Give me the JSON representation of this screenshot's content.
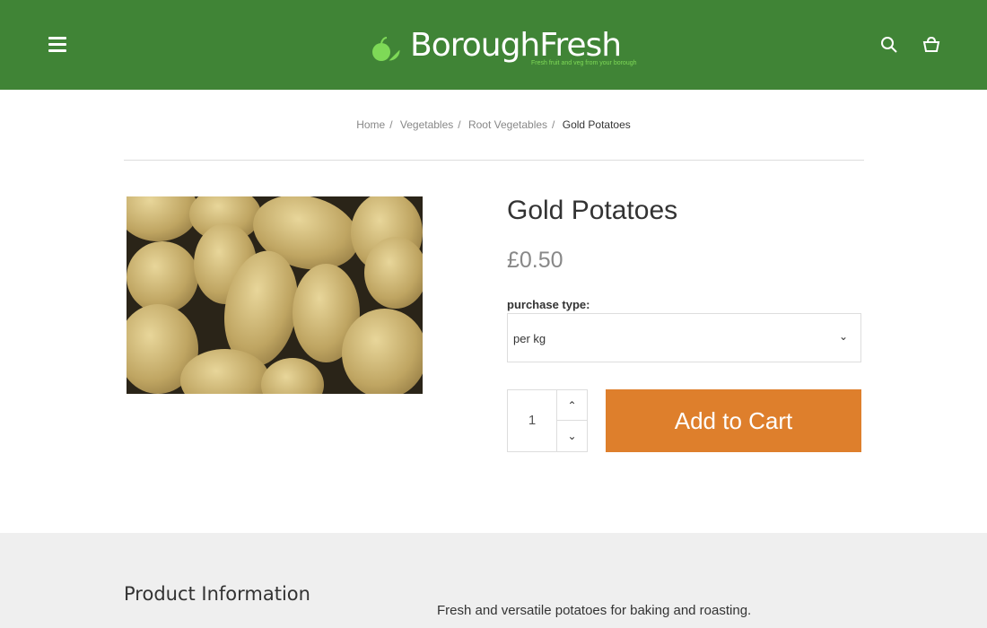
{
  "header": {
    "logo": "BoroughFresh",
    "tagline": "Fresh fruit and veg from your borough",
    "brand_color": "#408436",
    "icons": [
      "menu-icon",
      "search-icon",
      "shopping-bag-icon"
    ]
  },
  "breadcrumb": [
    "Home",
    "Vegetables",
    "Root Vegetables",
    "Gold Potatoes"
  ],
  "product": {
    "title": "Gold Potatoes",
    "price": "£0.50",
    "purchase_type_label": "purchase type:",
    "purchase_type_value": "per kg",
    "quantity": "1",
    "add_to_cart": "Add to Cart",
    "cart_color": "#de7f2c"
  },
  "info": {
    "heading": "Product Information",
    "description": "Fresh and versatile potatoes for baking and roasting."
  }
}
